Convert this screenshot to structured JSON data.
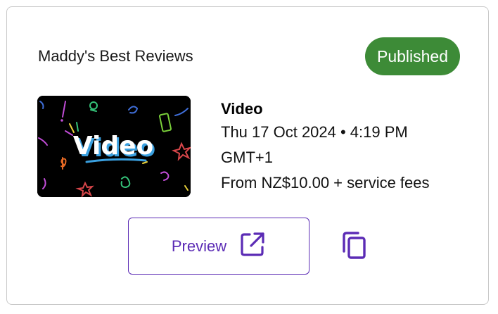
{
  "card": {
    "org_name": "Maddy's Best Reviews",
    "status": "Published",
    "status_color": "#3d8b37",
    "thumbnail": {
      "text": "Video"
    },
    "event": {
      "title": "Video",
      "datetime": "Thu 17 Oct 2024 • 4:19 PM",
      "timezone": "GMT+1",
      "price": "From NZ$10.00 + service fees"
    },
    "actions": {
      "preview_label": "Preview",
      "preview_icon": "external-link-icon",
      "copy_icon": "copy-icon"
    },
    "accent_color": "#5b2bb5"
  }
}
